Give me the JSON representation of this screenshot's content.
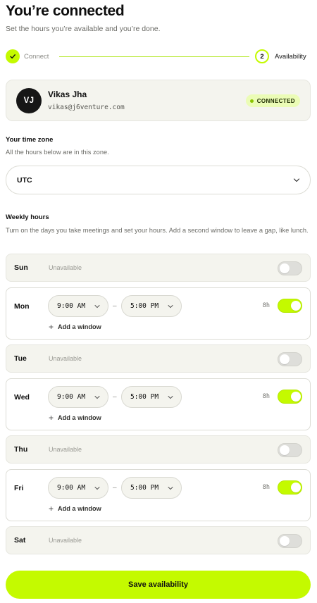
{
  "header": {
    "title": "You’re connected",
    "subtitle": "Set the hours you’re available and you’re done."
  },
  "stepper": {
    "steps": [
      {
        "label": "Connect",
        "status": "complete",
        "icon": "check-icon"
      },
      {
        "label": "Availability",
        "status": "current",
        "number": "2"
      }
    ]
  },
  "account": {
    "initials": "VJ",
    "name": "Vikas Jha",
    "email": "vikas@j6venture.com",
    "badge": "CONNECTED"
  },
  "timezone": {
    "label": "Your time zone",
    "help": "All the hours below are in this zone.",
    "value": "UTC"
  },
  "weekly": {
    "label": "Weekly hours",
    "help": "Turn on the days you take meetings and set your hours. Add a second window to leave a gap, like lunch.",
    "unavailable_text": "Unavailable",
    "add_window_text": "Add a window",
    "dash": "–",
    "days": [
      {
        "name": "Sun",
        "enabled": false
      },
      {
        "name": "Mon",
        "enabled": true,
        "start": "9:00 AM",
        "end": "5:00 PM",
        "hours": "8h"
      },
      {
        "name": "Tue",
        "enabled": false
      },
      {
        "name": "Wed",
        "enabled": true,
        "start": "9:00 AM",
        "end": "5:00 PM",
        "hours": "8h"
      },
      {
        "name": "Thu",
        "enabled": false
      },
      {
        "name": "Fri",
        "enabled": true,
        "start": "9:00 AM",
        "end": "5:00 PM",
        "hours": "8h"
      },
      {
        "name": "Sat",
        "enabled": false
      }
    ]
  },
  "actions": {
    "save_label": "Save availability"
  },
  "colors": {
    "accent": "#c4fa00",
    "card_bg": "#f4f4ee",
    "text": "#111111",
    "muted": "#6b6b66"
  }
}
